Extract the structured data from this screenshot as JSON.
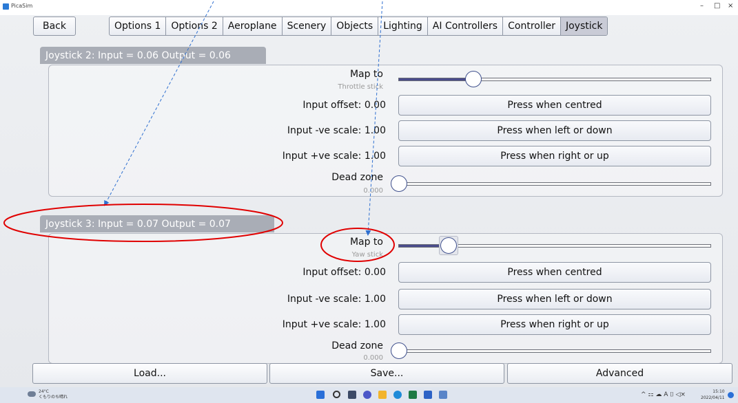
{
  "window": {
    "title": "PicaSim",
    "controls": {
      "minimize": "–",
      "maximize": "□",
      "close": "×"
    }
  },
  "nav": {
    "back_label": "Back",
    "tabs": [
      {
        "label": "Options 1"
      },
      {
        "label": "Options 2"
      },
      {
        "label": "Aeroplane"
      },
      {
        "label": "Scenery"
      },
      {
        "label": "Objects"
      },
      {
        "label": "Lighting"
      },
      {
        "label": "AI Controllers"
      },
      {
        "label": "Controller"
      },
      {
        "label": "Joystick",
        "active": true
      }
    ]
  },
  "joystick2": {
    "header": "Joystick 2: Input =  0.06 Output =  0.06",
    "map_to_label": "Map to",
    "map_to_value": "Throttle stick",
    "map_to_slider_fraction": 0.24,
    "input_offset_label": "Input offset: 0.00",
    "input_neg_scale_label": "Input -ve scale:  1.00",
    "input_pos_scale_label": "Input +ve scale:  1.00",
    "centred_button": "Press when centred",
    "left_down_button": "Press when left or down",
    "right_up_button": "Press when right or up",
    "dead_zone_label": "Dead zone",
    "dead_zone_value": "0.000",
    "dead_zone_fraction": 0.0
  },
  "joystick3": {
    "header": "Joystick 3: Input =  0.07 Output =  0.07",
    "map_to_label": "Map to",
    "map_to_value": "Yaw stick",
    "map_to_slider_fraction": 0.16,
    "input_offset_label": "Input offset:  0.00",
    "input_neg_scale_label": "Input -ve scale:  1.00",
    "input_pos_scale_label": "Input +ve scale:  1.00",
    "centred_button": "Press when centred",
    "left_down_button": "Press when left or down",
    "right_up_button": "Press when right or up",
    "dead_zone_label": "Dead zone",
    "dead_zone_value": "0.000",
    "dead_zone_fraction": 0.0
  },
  "footer": {
    "load_label": "Load...",
    "save_label": "Save...",
    "advanced_label": "Advanced"
  },
  "taskbar": {
    "weather_temp": "24°C",
    "weather_text": "くもりのち晴れ",
    "tray_text": "^ ⚏ ☁ A ⌷ ◁×",
    "time": "15:10",
    "date": "2022/04/11"
  },
  "colors": {
    "accent": "#4a4c8c",
    "annotation_red": "#e00000",
    "annotation_blue": "#2e6fd0"
  }
}
